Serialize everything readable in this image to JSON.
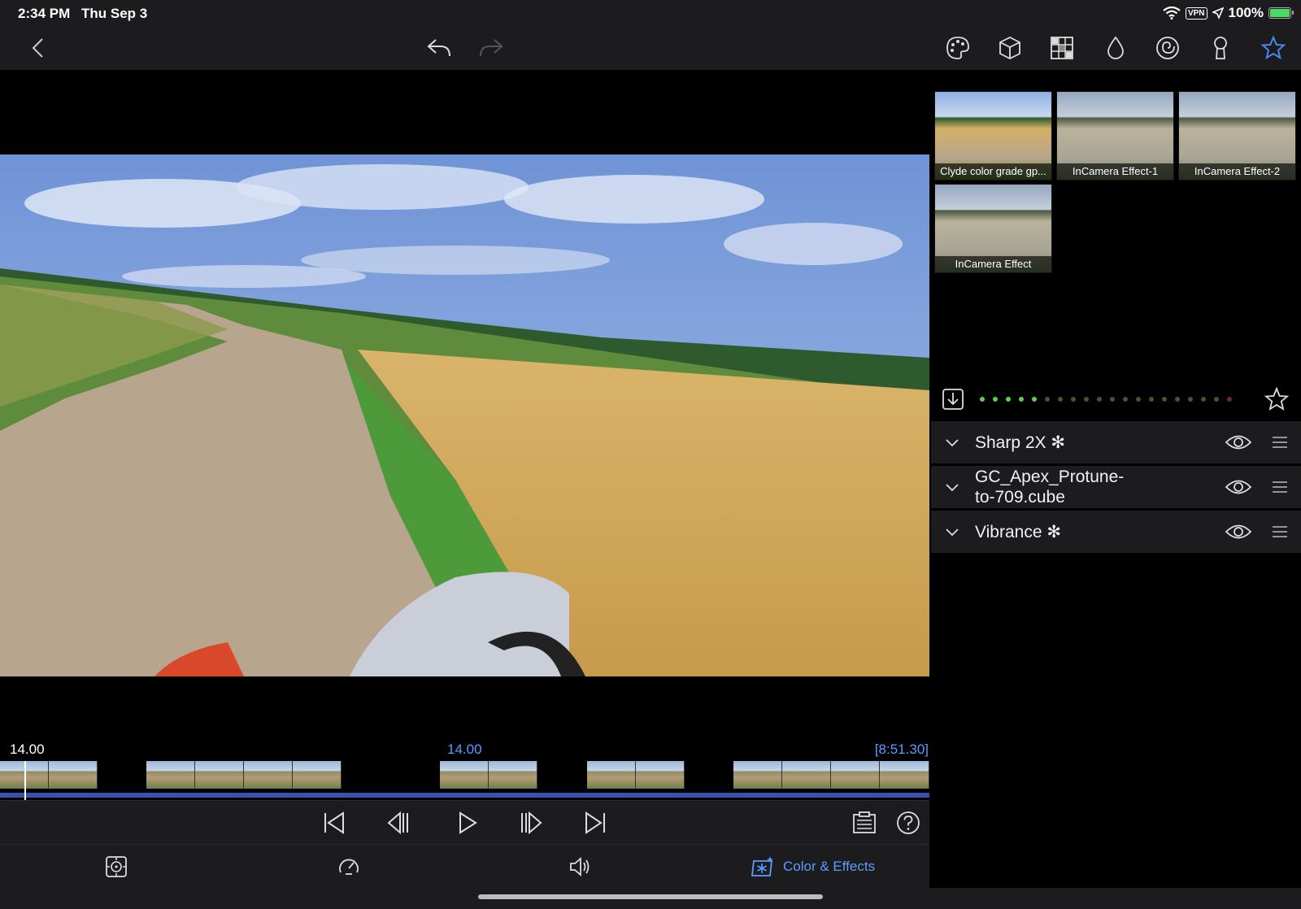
{
  "status": {
    "time": "2:34 PM",
    "date": "Thu Sep 3",
    "vpn": "VPN",
    "battery": "100%"
  },
  "toolbar": {
    "icons": [
      "chevron-left-icon",
      "undo-icon",
      "redo-icon",
      "palette-icon",
      "cube-icon",
      "grid-icon",
      "droplet-icon",
      "spiral-icon",
      "keyhole-icon",
      "star-icon"
    ],
    "accent": "#4a86f0"
  },
  "timeline": {
    "current_left": "14.00",
    "current_mid": "14.00",
    "duration": "[8:51.30]"
  },
  "presets": [
    {
      "label": "Clyde color grade gp..."
    },
    {
      "label": "InCamera Effect-1"
    },
    {
      "label": "InCamera Effect-2"
    },
    {
      "label": "InCamera Effect"
    }
  ],
  "pager": {
    "total": 20,
    "active": 5
  },
  "layers": [
    {
      "name": "Sharp 2X ✻"
    },
    {
      "name": "GC_Apex_Protune-\nto-709.cube"
    },
    {
      "name": "Vibrance ✻"
    }
  ],
  "tabs": {
    "active_label": "Color & Effects"
  },
  "colors": {
    "accent": "#5a9cff",
    "panel": "#1c1c1e",
    "dot_on": "#5bd04a"
  }
}
